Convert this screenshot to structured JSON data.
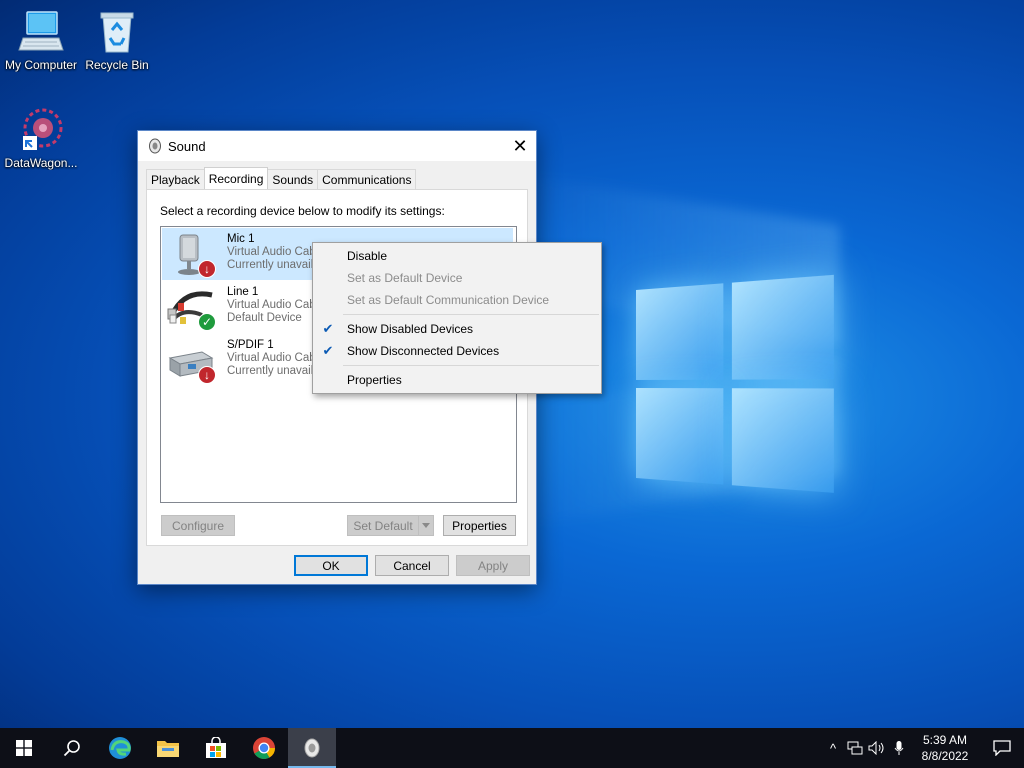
{
  "desktop": {
    "icons": [
      {
        "label": "My Computer",
        "icon": "computer-icon"
      },
      {
        "label": "Recycle Bin",
        "icon": "recycle-bin-icon"
      },
      {
        "label": "DataWagon...",
        "icon": "datawagon-shortcut-icon"
      }
    ]
  },
  "dialog": {
    "title": "Sound",
    "close_label": "✕",
    "tabs": [
      {
        "label": "Playback",
        "active": false
      },
      {
        "label": "Recording",
        "active": true
      },
      {
        "label": "Sounds",
        "active": false
      },
      {
        "label": "Communications",
        "active": false
      }
    ],
    "instruction": "Select a recording device below to modify its settings:",
    "devices": [
      {
        "name": "Mic 1",
        "line1": "Virtual Audio Cab",
        "line2": "Currently unavail",
        "status": "down",
        "icon": "microphone-icon",
        "selected": true
      },
      {
        "name": "Line 1",
        "line1": "Virtual Audio Cab",
        "line2": "Default Device",
        "status": "ok",
        "icon": "line-in-cable-icon",
        "selected": false
      },
      {
        "name": "S/PDIF 1",
        "line1": "Virtual Audio Cab",
        "line2": "Currently unavail",
        "status": "down",
        "icon": "spdif-device-icon",
        "selected": false
      }
    ],
    "buttons": {
      "configure": "Configure",
      "set_default": "Set Default",
      "properties": "Properties",
      "ok": "OK",
      "cancel": "Cancel",
      "apply": "Apply"
    }
  },
  "context_menu": {
    "items": [
      {
        "label": "Disable",
        "enabled": true,
        "checked": false
      },
      {
        "label": "Set as Default Device",
        "enabled": false,
        "checked": false
      },
      {
        "label": "Set as Default Communication Device",
        "enabled": false,
        "checked": false
      },
      {
        "separator": true
      },
      {
        "label": "Show Disabled Devices",
        "enabled": true,
        "checked": true
      },
      {
        "label": "Show Disconnected Devices",
        "enabled": true,
        "checked": true
      },
      {
        "separator": true
      },
      {
        "label": "Properties",
        "enabled": true,
        "checked": false
      }
    ]
  },
  "taskbar": {
    "apps": [
      "start-icon",
      "search-icon",
      "edge-icon",
      "file-explorer-icon",
      "store-icon",
      "chrome-icon",
      "sound-settings-icon"
    ],
    "active_app": "sound-settings-icon",
    "tray": {
      "chevron": "^",
      "time": "5:39 AM",
      "date": "8/8/2022"
    }
  },
  "colors": {
    "accent": "#0078d7",
    "selection": "#cce8ff",
    "taskbar": "#0d0f17",
    "status_down": "#c1272d",
    "status_ok": "#1f9b3d"
  }
}
